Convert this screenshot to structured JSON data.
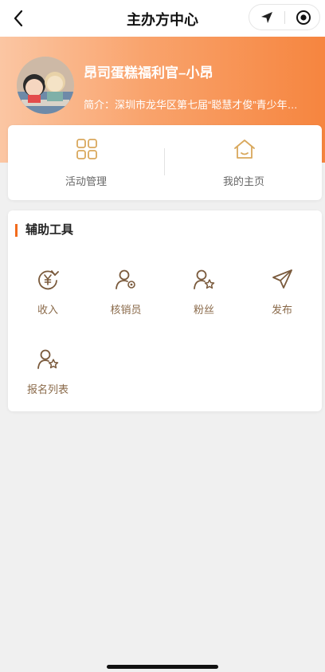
{
  "navbar": {
    "title": "主办方中心",
    "back_icon": "chevron-left-icon",
    "capsule": {
      "left_icon": "location-arrow-icon",
      "right_icon": "record-target-icon"
    }
  },
  "profile": {
    "name": "昂司蛋糕福利官–小昂",
    "intro": "简介：深圳市龙华区第七届“聪慧才俊”青少年…",
    "banner_colors": [
      "#fbc6a3",
      "#f6853f"
    ]
  },
  "quick_actions": [
    {
      "label": "活动管理",
      "icon": "grid-icon"
    },
    {
      "label": "我的主页",
      "icon": "home-icon"
    }
  ],
  "tools": {
    "title": "辅助工具",
    "accent": "#f26b1d",
    "items": [
      {
        "label": "收入",
        "icon": "yuan-refresh-icon"
      },
      {
        "label": "核销员",
        "icon": "user-gear-icon"
      },
      {
        "label": "粉丝",
        "icon": "user-star-icon"
      },
      {
        "label": "发布",
        "icon": "send-icon"
      },
      {
        "label": "报名列表",
        "icon": "user-star-icon"
      }
    ]
  }
}
